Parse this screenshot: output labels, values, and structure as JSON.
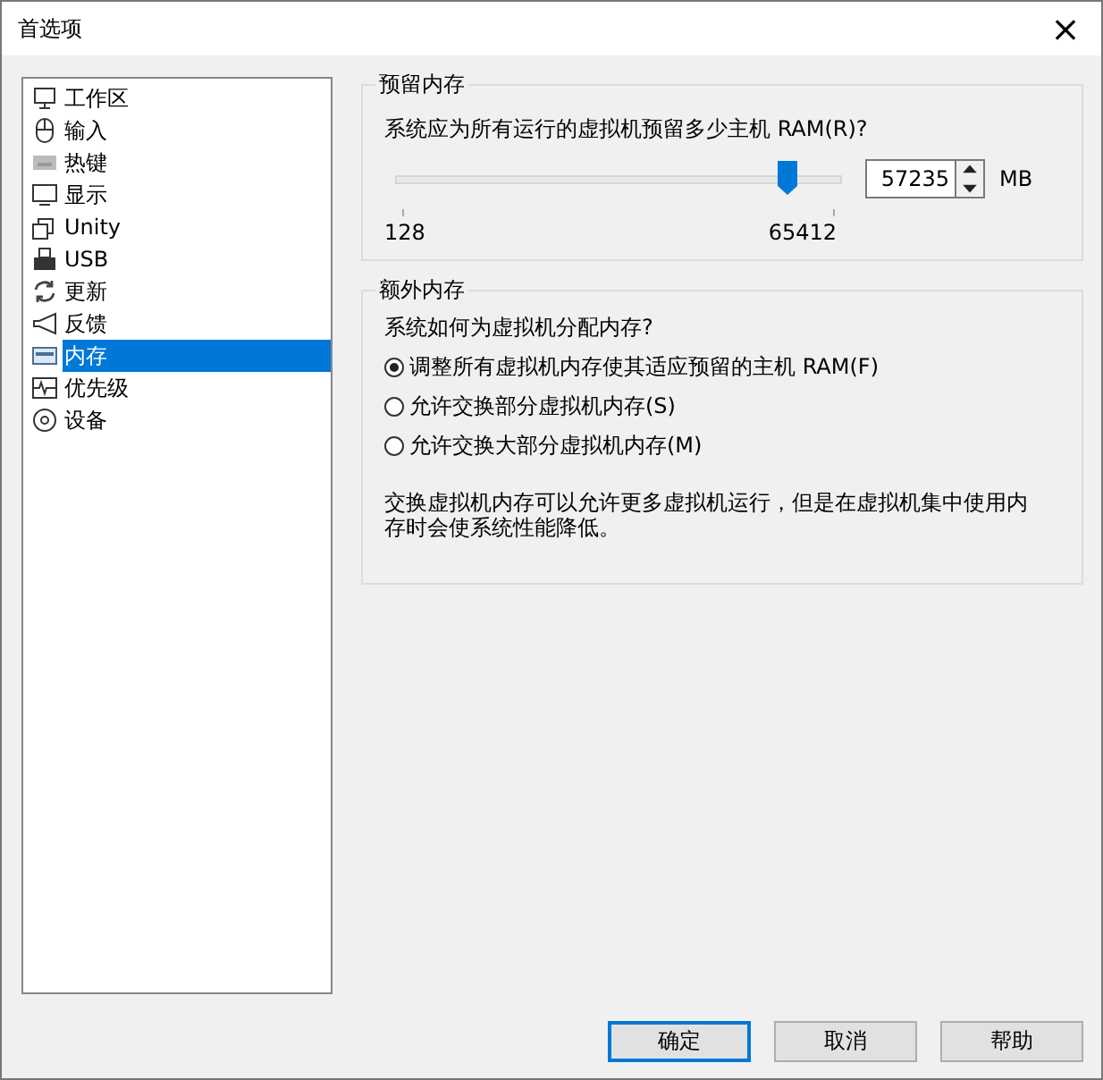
{
  "window": {
    "title": "首选项",
    "close": "×"
  },
  "sidebar": {
    "items": [
      {
        "label": "工作区",
        "selected": false
      },
      {
        "label": "输入",
        "selected": false
      },
      {
        "label": "热键",
        "selected": false
      },
      {
        "label": "显示",
        "selected": false
      },
      {
        "label": "Unity",
        "selected": false
      },
      {
        "label": "USB",
        "selected": false
      },
      {
        "label": "更新",
        "selected": false
      },
      {
        "label": "反馈",
        "selected": false
      },
      {
        "label": "内存",
        "selected": true
      },
      {
        "label": "优先级",
        "selected": false
      },
      {
        "label": "设备",
        "selected": false
      }
    ]
  },
  "reserved": {
    "title": "预留内存",
    "question": "系统应为所有运行的虚拟机预留多少主机 RAM(R)?",
    "level": 0.875,
    "value": "57235",
    "unit": "MB",
    "min_label": "128",
    "max_label": "65412"
  },
  "extra": {
    "title": "额外内存",
    "question": "系统如何为虚拟机分配内存?",
    "options": [
      {
        "label": "调整所有虚拟机内存使其适应预留的主机 RAM(F)",
        "selected": true
      },
      {
        "label": "允许交换部分虚拟机内存(S)",
        "selected": false
      },
      {
        "label": "允许交换大部分虚拟机内存(M)",
        "selected": false
      }
    ],
    "note": "交换虚拟机内存可以允许更多虚拟机运行，但是在虚拟机集中使用内存时会使系统性能降低。"
  },
  "buttons": [
    {
      "label": "确定",
      "default": true
    },
    {
      "label": "取消",
      "default": false
    },
    {
      "label": "帮助",
      "default": false
    }
  ]
}
